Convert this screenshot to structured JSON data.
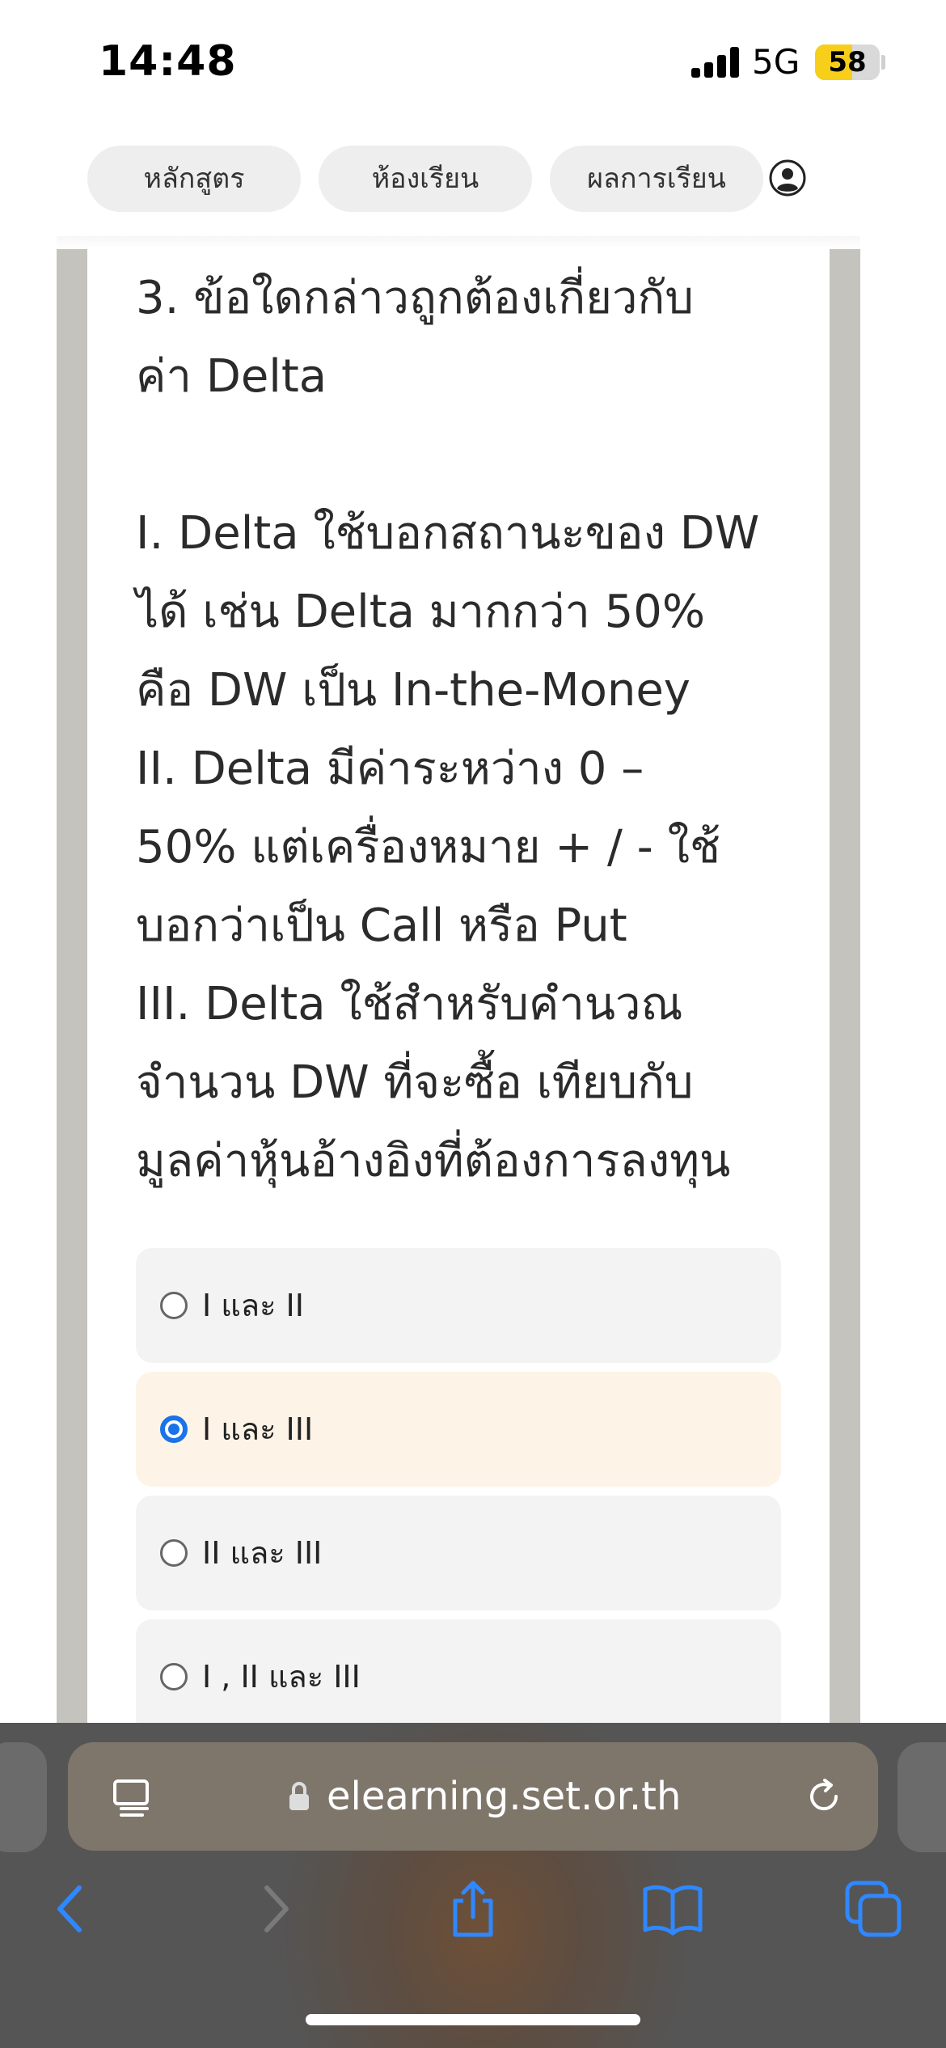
{
  "status": {
    "time": "14:48",
    "network": "5G",
    "battery": "58",
    "battery_level": 0.58
  },
  "nav": {
    "tabs": [
      "หลักสูตร",
      "ห้องเรียน",
      "ผลการเรียน"
    ]
  },
  "question": {
    "lines": [
      "3. ข้อใดกล่าวถูกต้องเกี่ยวกับ",
      "ค่า Delta",
      "",
      "I. Delta ใช้บอกสถานะของ DW",
      "ได้ เช่น Delta มากกว่า 50%",
      "คือ DW เป็น In-the-Money",
      "II. Delta มีค่าระหว่าง 0 –",
      "50% แต่เครื่องหมาย + / - ใช้",
      "บอกว่าเป็น Call หรือ Put",
      "III. Delta ใช้สำหรับคำนวณ",
      "จำนวน DW ที่จะซื้อ เทียบกับ",
      "มูลค่าหุ้นอ้างอิงที่ต้องการลงทุน"
    ]
  },
  "options": [
    {
      "label": "I และ II",
      "selected": false
    },
    {
      "label": "I และ III",
      "selected": true
    },
    {
      "label": "II และ III",
      "selected": false
    },
    {
      "label": "I , II และ III",
      "selected": false
    }
  ],
  "browser": {
    "url": "elearning.set.or.th"
  },
  "colors": {
    "accent": "#1a73e8",
    "selected_bg": "#fdf4e7",
    "battery": "#f7cf1b"
  }
}
